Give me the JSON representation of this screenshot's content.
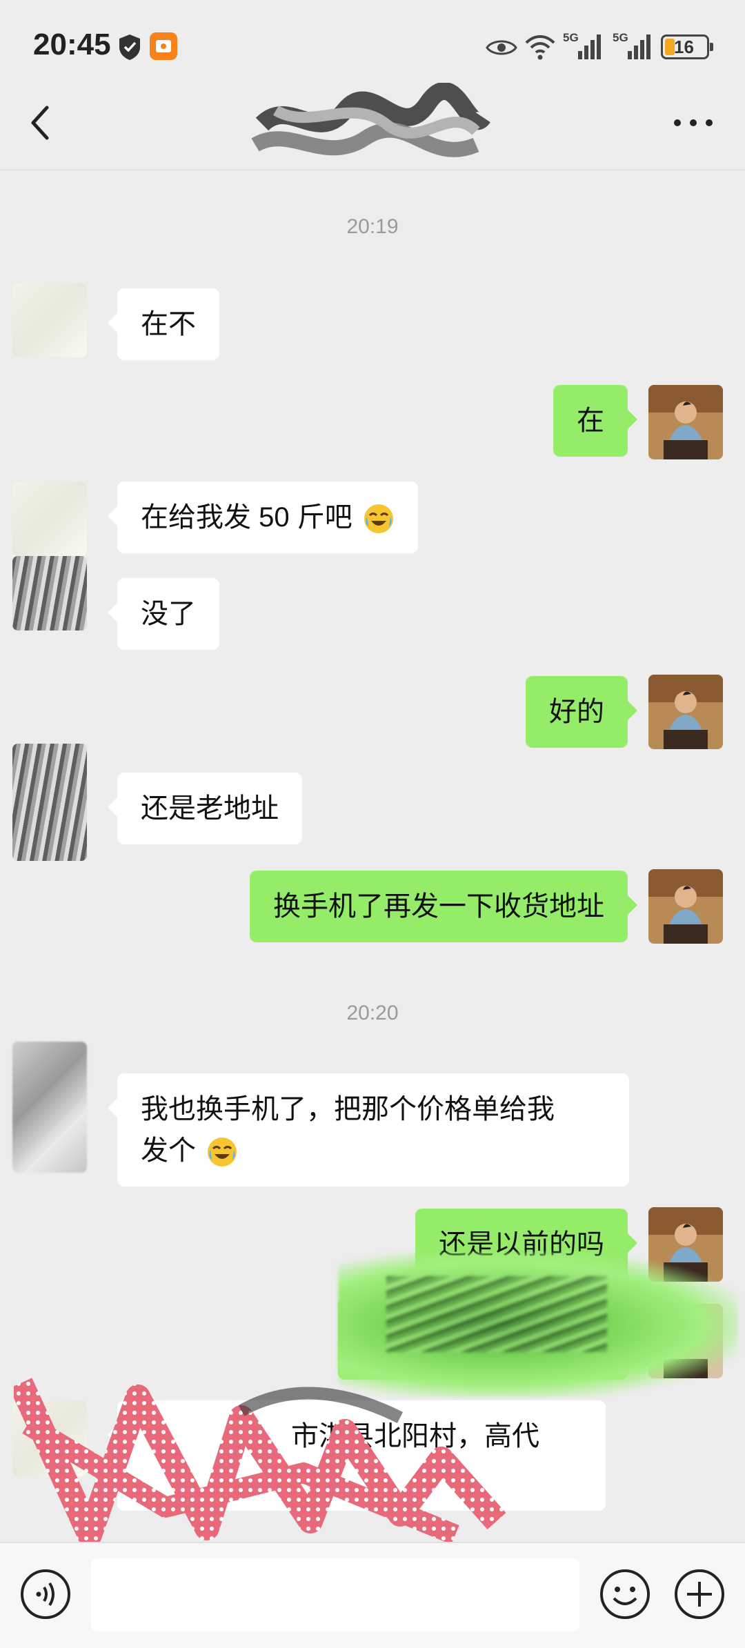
{
  "status_bar": {
    "time": "20:45",
    "battery": "16",
    "signal1": "5G",
    "signal2": "5G"
  },
  "nav": {
    "title_obscured": true
  },
  "messages": {
    "ts1": "20:19",
    "m1": "在不",
    "m2": "在",
    "m3": "在给我发 50 斤吧",
    "m4": "没了",
    "m5": "好的",
    "m6": "还是老地址",
    "m7": "换手机了再发一下收货地址",
    "ts2": "20:20",
    "m8_line1": "我也换手机了，把那个价格单给我",
    "m8_line2": "发个",
    "m9": "还是以前的吗",
    "m10_partial": "市淇县北阳村，高代"
  },
  "colors": {
    "me_bubble": "#95ec69",
    "them_bubble": "#ffffff",
    "background": "#ededed"
  },
  "icons": [
    "shield-icon",
    "app-badge-icon",
    "eye-icon",
    "wifi-icon",
    "signal-icon",
    "battery-icon",
    "back-icon",
    "more-icon",
    "voice-icon",
    "emoji-icon",
    "plus-icon",
    "crying-laughing-emoji"
  ]
}
